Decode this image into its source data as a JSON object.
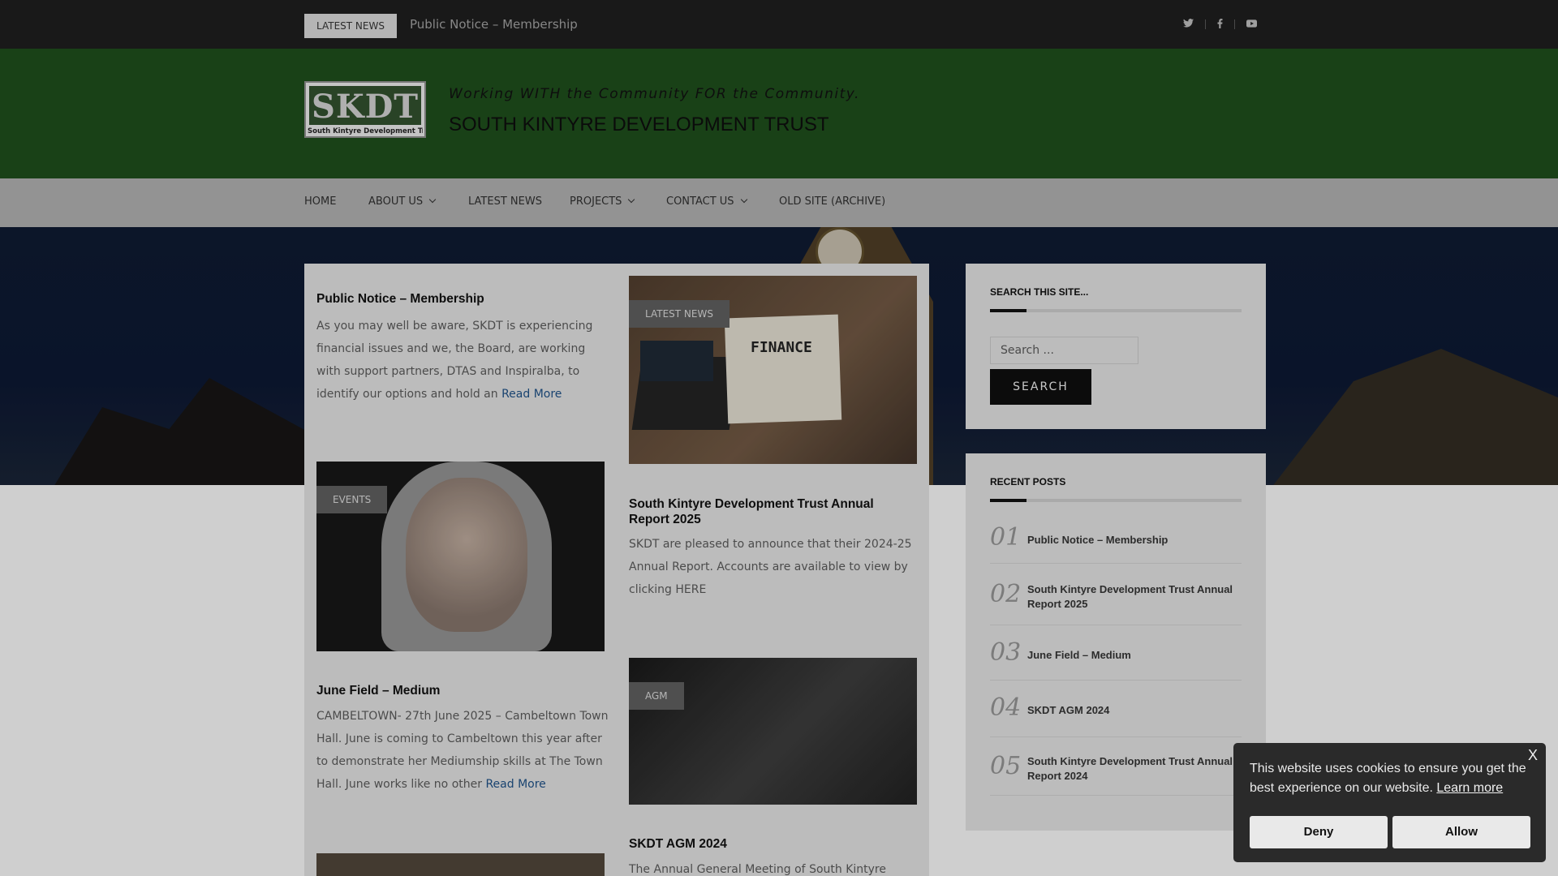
{
  "topbar": {
    "news_label": "LATEST NEWS",
    "ticker": "Public Notice – Membership",
    "social": [
      {
        "name": "twitter-icon",
        "glyph": "𝕥"
      },
      {
        "name": "facebook-icon",
        "glyph": "f"
      },
      {
        "name": "youtube-icon",
        "glyph": "▶"
      }
    ]
  },
  "header": {
    "logo_text": "SKDT",
    "logo_subtext": "South Kintyre Development Trust",
    "tagline": "Working WITH the Community FOR the Community.",
    "site_title": "SOUTH KINTYRE DEVELOPMENT TRUST"
  },
  "nav": {
    "items": [
      {
        "label": "HOME",
        "has_dropdown": false
      },
      {
        "label": "ABOUT US",
        "has_dropdown": true
      },
      {
        "label": "LATEST NEWS",
        "has_dropdown": false
      },
      {
        "label": "PROJECTS",
        "has_dropdown": true
      },
      {
        "label": "CONTACT US",
        "has_dropdown": true
      },
      {
        "label": "OLD SITE (ARCHIVE)",
        "has_dropdown": false
      }
    ]
  },
  "posts": [
    {
      "title": "Public Notice – Membership",
      "excerpt": "As you may well be aware, SKDT is experiencing financial issues and we, the Board, are working with support partners, DTAS and Inspiralba, to identify our options and hold an",
      "read_more": "Read More"
    },
    {
      "category": "LATEST NEWS",
      "title": "South Kintyre Development Trust Annual Report 2025",
      "excerpt": "SKDT are pleased to announce that their 2024-25 Annual Report. Accounts are available to view by clicking HERE",
      "image_text": "FINANCE"
    },
    {
      "category": "EVENTS",
      "title": "June Field – Medium",
      "excerpt": "CAMBELTOWN- 27th June 2025 – Cambeltown Town Hall. June is coming to Cambeltown this year after to demonstrate her Mediumship skills at The Town Hall. June works like no other",
      "read_more": "Read More"
    },
    {
      "category": "AGM",
      "title": "SKDT AGM 2024",
      "excerpt": "The Annual General Meeting of South Kintyre"
    }
  ],
  "sidebar": {
    "search": {
      "title": "SEARCH THIS SITE...",
      "placeholder": "Search ...",
      "button": "SEARCH"
    },
    "recent": {
      "title": "RECENT POSTS",
      "items": [
        {
          "num": "01",
          "title": "Public Notice – Membership"
        },
        {
          "num": "02",
          "title": "South Kintyre Development Trust Annual Report 2025"
        },
        {
          "num": "03",
          "title": "June Field – Medium"
        },
        {
          "num": "04",
          "title": "SKDT AGM 2024"
        },
        {
          "num": "05",
          "title": "South Kintyre Development Trust Annual Report 2024"
        }
      ]
    }
  },
  "cookie": {
    "close": "X",
    "message": "This website uses cookies to ensure you get the best experience on our website.",
    "learn_more": "Learn more",
    "deny": "Deny",
    "allow": "Allow"
  }
}
